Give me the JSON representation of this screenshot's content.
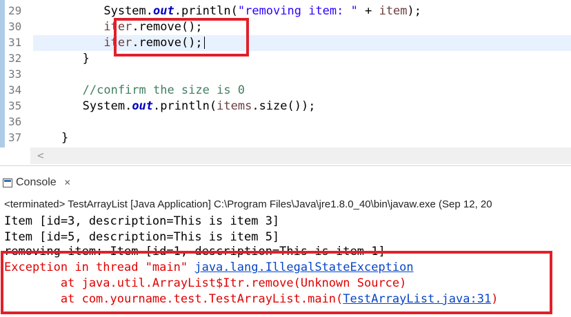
{
  "editor": {
    "line_numbers": [
      "29",
      "30",
      "31",
      "32",
      "33",
      "34",
      "35",
      "36",
      "37"
    ],
    "line29": {
      "indent": "          ",
      "a": "System.",
      "b": "out",
      "c": ".println(",
      "d": "\"removing item: \"",
      "e": " + ",
      "f": "item",
      "g": ");"
    },
    "line30": {
      "indent": "          ",
      "a": "iter",
      "b": ".remove();"
    },
    "line31": {
      "indent": "          ",
      "a": "iter",
      "b": ".remove();"
    },
    "line32": {
      "text": "       }"
    },
    "line34": {
      "text": "       //confirm the size is 0"
    },
    "line35": {
      "indent": "       ",
      "a": "System.",
      "b": "out",
      "c": ".println(",
      "d": "items",
      "e": ".size());"
    },
    "line37": {
      "text": "    }"
    },
    "scroll_left_arrow": "<"
  },
  "console": {
    "tab_label": "Console",
    "tab_close": "✕",
    "status": "<terminated> TestArrayList [Java Application] C:\\Program Files\\Java\\jre1.8.0_40\\bin\\javaw.exe (Sep 12, 20",
    "lines": [
      "Item [id=3, description=This is item 3]",
      "Item [id=5, description=This is item 5]",
      "removing item: Item [id=1, description=This is item 1]"
    ],
    "exception_prefix": "Exception in thread \"main\" ",
    "exception_class": "java.lang.IllegalStateException",
    "trace1": "        at java.util.ArrayList$Itr.remove(Unknown Source)",
    "trace2_prefix": "        at com.yourname.test.TestArrayList.main(",
    "trace2_link": "TestArrayList.java:31",
    "trace2_suffix": ")"
  },
  "colors": {
    "highlight_box": "#e0202a",
    "error_text": "#e00000",
    "link": "#0645c8"
  }
}
